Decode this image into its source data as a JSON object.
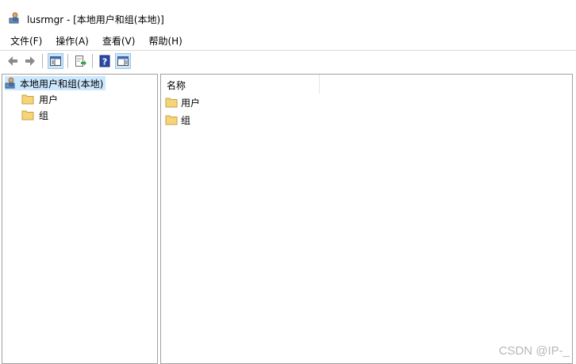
{
  "window": {
    "title": "lusrmgr - [本地用户和组(本地)]"
  },
  "menu": [
    {
      "label": "文件(F)"
    },
    {
      "label": "操作(A)"
    },
    {
      "label": "查看(V)"
    },
    {
      "label": "帮助(H)"
    }
  ],
  "toolbar": {
    "icons": [
      "back-arrow-icon",
      "forward-arrow-icon",
      "show-console-tree-icon",
      "export-list-icon",
      "help-icon",
      "show-action-pane-icon"
    ]
  },
  "tree": {
    "root": {
      "label": "本地用户和组(本地)"
    },
    "items": [
      {
        "label": "用户"
      },
      {
        "label": "组"
      }
    ]
  },
  "list": {
    "column_header": "名称",
    "items": [
      {
        "label": "用户"
      },
      {
        "label": "组"
      }
    ]
  },
  "watermark": "CSDN @IP-_",
  "colors": {
    "selection": "#cce8ff",
    "folder": "#f5d47a",
    "border": "#a0a0a0"
  }
}
